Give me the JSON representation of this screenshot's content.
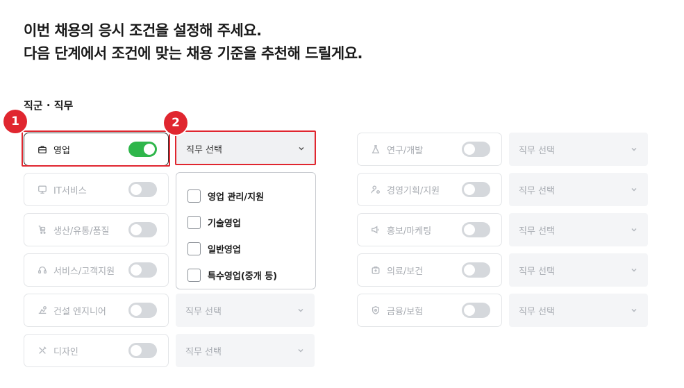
{
  "header": {
    "line1": "이번 채용의 응시 조건을 설정해 주세요.",
    "line2": "다음 단계에서 조건에 맞는 채용 기준을 추천해 드릴게요."
  },
  "section": {
    "label": "직군 · 직무"
  },
  "select_placeholder": "직무 선택",
  "categories_left": [
    {
      "label": "영업",
      "icon": "briefcase-icon",
      "on": true
    },
    {
      "label": "IT서비스",
      "icon": "monitor-icon",
      "on": false
    },
    {
      "label": "생산/유통/품질",
      "icon": "cart-icon",
      "on": false
    },
    {
      "label": "서비스/고객지원",
      "icon": "headset-icon",
      "on": false
    },
    {
      "label": "건설 엔지니어",
      "icon": "hardhat-icon",
      "on": false
    },
    {
      "label": "디자인",
      "icon": "pencil-ruler-icon",
      "on": false
    }
  ],
  "categories_right": [
    {
      "label": "연구/개발",
      "icon": "flask-icon",
      "on": false
    },
    {
      "label": "경영기획/지원",
      "icon": "user-gear-icon",
      "on": false
    },
    {
      "label": "홍보/마케팅",
      "icon": "megaphone-icon",
      "on": false
    },
    {
      "label": "의료/보건",
      "icon": "medical-bag-icon",
      "on": false
    },
    {
      "label": "금융/보험",
      "icon": "shield-icon",
      "on": false
    }
  ],
  "dropdown_options": [
    "영업 관리/지원",
    "기술영업",
    "일반영업",
    "특수영업(중개 등)"
  ],
  "annotations": {
    "badge1": "1",
    "badge2": "2"
  },
  "colors": {
    "toggle_on": "#2fb64b",
    "toggle_off": "#d5d8dc",
    "highlight": "#e0262f"
  }
}
